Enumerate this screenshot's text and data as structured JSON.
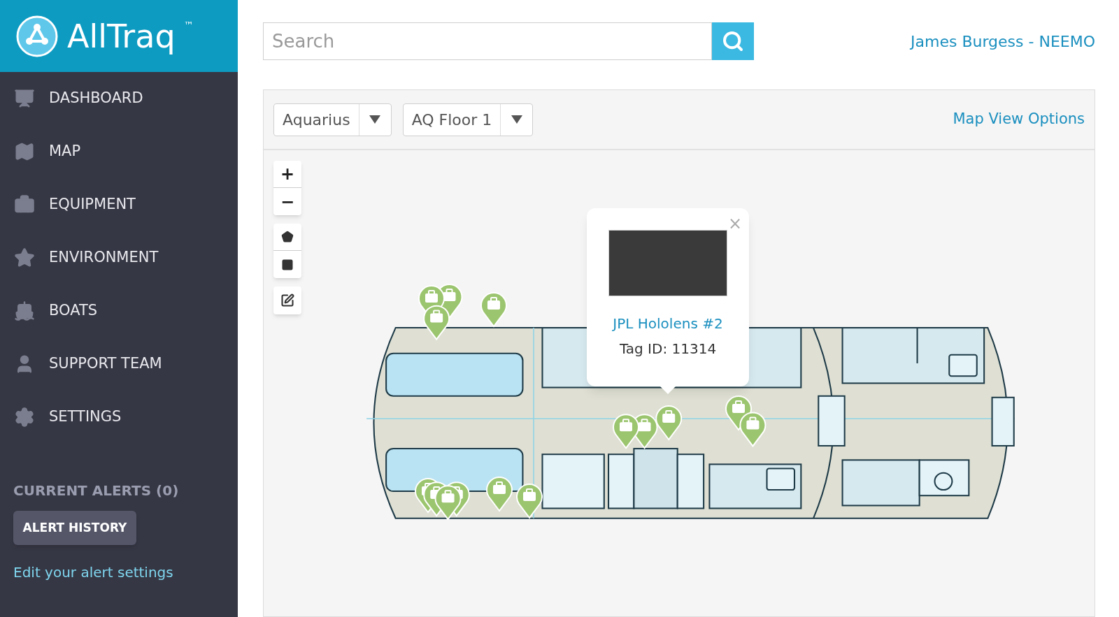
{
  "logo": {
    "name": "AllTraq",
    "mark": "™"
  },
  "nav": [
    {
      "label": "DASHBOARD"
    },
    {
      "label": "MAP"
    },
    {
      "label": "EQUIPMENT"
    },
    {
      "label": "ENVIRONMENT"
    },
    {
      "label": "BOATS"
    },
    {
      "label": "SUPPORT TEAM"
    },
    {
      "label": "SETTINGS"
    }
  ],
  "alerts": {
    "title": "CURRENT ALERTS (0)",
    "button": "ALERT HISTORY",
    "link": "Edit your alert settings"
  },
  "search": {
    "placeholder": "Search"
  },
  "user": "James Burgess - NEEMO",
  "map": {
    "selects": [
      {
        "value": "Aquarius"
      },
      {
        "value": "AQ Floor 1"
      }
    ],
    "options_link": "Map View Options",
    "zoom": [
      "+",
      "−"
    ],
    "popup": {
      "title": "JPL Hololens #2",
      "tag": "Tag ID: 11314",
      "close": "×"
    }
  }
}
